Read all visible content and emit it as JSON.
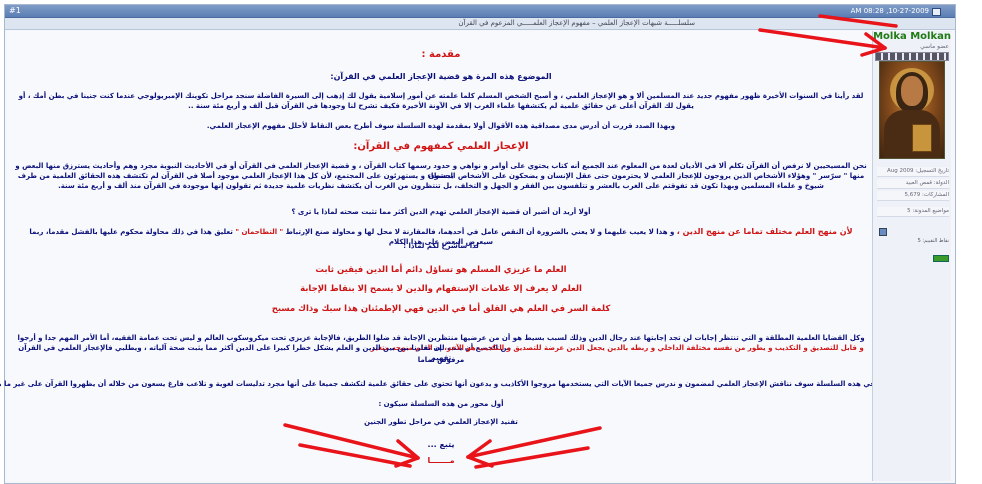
{
  "header": {
    "post_number": "#1",
    "date": "AM 08:28 ,10-27-2009"
  },
  "thread": {
    "title": "سلسلـــــة شبهات الإعجاز العلمي – مفهوم الإعجاز العلمـــــي المزعوم في القرآن"
  },
  "user": {
    "name": "Molka Molkan",
    "title": "عضو ماسي",
    "info": [
      "تاريخ التسجيل: Aug 2009",
      "الدولة: قمص العبيد",
      "المشاركات: 5,679",
      "مواضيع المدونة: 5"
    ],
    "reputation": "نقاط التقييم: 5"
  },
  "post": {
    "heading_intro": "مقدمة :",
    "p1": "الموضوع هذه المرة هو قضية الإعجاز العلمي في القرآن:",
    "p2a": "لقد رأينا في السنوات الأخيرة ظهور مفهوم جديد عند المسلمين ألا و هو الإعجاز العلمي ، و أصبح الشخص المسلم كلما علمته عن أمور إسلامية يقول لك إذهب إلى السيرة الفاضلة سنجد مراحل تكوينك الإمبريولوجي عندما كنت جنينا في بطن أمك ، أو",
    "p2b": "يقول لك القرآن أعلى عن حقائق علمية لم يكتشفها علماء الغرب إلا في الآونة الأخيرة فكيف تشرح لنا وجودها في القرآن قبل ألف و أربع مئة سنة ..",
    "p3": "وبهذا الصدد قررت أن أدرس مدى مصداقية هذه الأقوال أولا بمقدمة لهذه السلسلة سوف أطرح بعض النقاط لأحلل مفهوم الإعجاز العلمي.",
    "heading_concept": "الإعجاز العلمي كمفهوم في القرآن:",
    "p4a": "نحن المسيحيين لا نرفض أن القرآن تكلم ألا في الأديان لعدة من المعلوم عند الجميع أنه كتاب يحتوي على أوامر و نواهي و حدود رسمها كتاب القرآن ، و قضية الإعجاز العلمي في القرآن أو في الأحاديث النبوية مجرد وهم وأحاديث يسترزق منها البعض و يحشون",
    "p4b": "منها \" سرّسر \" وهؤلاء الأشخاص الذين يروجون للإعجاز العلمي لا يحترمون حتى عقل الإنسان و يضحكون على الأشخاص البسطاء و يستهزئون على المجتمع، لأن كل هذا الإعجاز العلمي موجود أصلا في القرآن لم تكتشف هذه الحقائق العلمية من طرف",
    "p4c": "شيوخ و علماء المسلمين وبهذا تكون قد تفوقتم على الغرب بالعشر و تتلفسون بين الفقر و الجهل و التخلف، بل تنتظرون من الغرب أن يكتشف نظريات علمية جديدة ثم تقولون إنها موجودة في القرآن منذ ألف و أربع مئة سنة.",
    "p5": "أولا أريد أن أشير أن قضية الإعجاز العلمي تهدم الدين أكثر مما تثبت صحته لماذا يا ترى ؟",
    "p6a_red": "لأن منهج العلم مختلف تماما عن منهج الدين ،",
    "p6a_navy": "و هذا لا يعيب عليهما و لا يعني بالضرورة أن النقص عامل في أحدهما، فالمقارنة لا محل لها و محاولة صنع الإرتباط",
    "p6a_red2": "\" التطاحمان \"",
    "p6a_navy2": "تعليق هذا في ذلك محاولة محكوم عليها بالفشل مقدما، ربما سيعرض البعض على هذا الكلام",
    "p6b": "لذا سأشرح لكم لماذا :",
    "r1": "العلم ما عزيزي المسلم هو تساؤل دائم أما الدين فيقين ثابت",
    "r2": "العلم لا يعرف إلا علامات الإستفهام والدين لا يسمح إلا بنقاط الإجابة",
    "r3": "كلمة السر في العلم هي القلق أما في الدين فهي الإطمئنان هذا سبك وذاك مسبح",
    "p7a_navy": "وكل القضايا العلمية المطلقة و التي تنتظر إجابات لن تجد إجابتها عند رجال الدين وذلك لسبب بسيط هو أن من عرضيها منتظرين الإجابة قد ضلوا الطريق، فالإجابة عزيزي تحت ميكروسكوب العالم و ليس تحت عمامة الفقيه، أما الأمر المهم جدا و أرجوا من الجميع أن ينتبه له،",
    "p7a_red": "العلم منهجه متغير",
    "p7b_red": "و قابل للتصديق و التكذيب و يطور من نفسه مختلفة الداخلي و ربطه بالدين يجعل الدين عرضة للتصديق و التكذيب هو الآخر،",
    "p7b_navy": "إن تقارنا بين بين الدين و العلم يشكل خطرا كبيرا على الدين أكثر مما يثبت صحة آلياته ، ويطلبي فالإعجاز العلمي في القرآن تفهيم",
    "p7c": "مرفوض تماما",
    "p8": "في هذه السلسلة سوف نناقش الإعجاز العلمي لمضمون و ندرس جميعا الآيات التي يستخدمها مروجوا الأكاذيب و يدعون أنها تحتوي على حقائق علمية لتكشف جميعا على أنها مجرد تدليسات لغوية و تلاعب فارغ يسعون من خلاله أن يظهروا القرآن على غير ما هو عليه.",
    "p9": "أول محور من هذه السلسلة سيكون :",
    "p10": "تفنيد الإعجاز العلمي في مراحل تطور الجنين",
    "p11": "يتبع ...",
    "p12": "مـــــــا"
  },
  "annotations": {
    "arrow_color": "#e8141a"
  }
}
